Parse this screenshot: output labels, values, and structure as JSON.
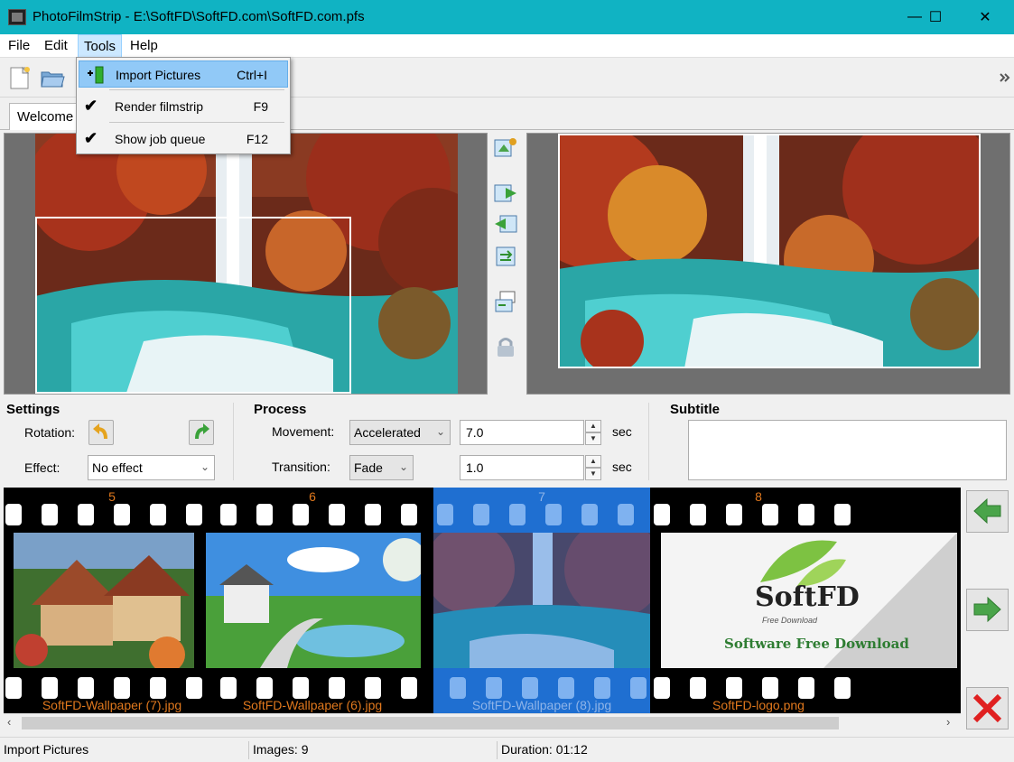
{
  "window": {
    "title": "PhotoFilmStrip - E:\\SoftFD\\SoftFD.com\\SoftFD.com.pfs",
    "minimize_glyph": "—",
    "maximize_glyph": "☐",
    "close_glyph": "✕"
  },
  "menubar": {
    "items": [
      "File",
      "Edit",
      "Tools",
      "Help"
    ]
  },
  "tools_menu": {
    "items": [
      {
        "label": "Import Pictures",
        "shortcut": "Ctrl+I",
        "icon": "import-pictures-icon"
      },
      {
        "label": "Render filmstrip",
        "shortcut": "F9",
        "icon": "checkmark-icon",
        "check": "✔"
      },
      {
        "label": "Show job queue",
        "shortcut": "F12",
        "icon": "checkmark-icon",
        "check": "✔"
      }
    ]
  },
  "tabs": {
    "active": "Welcome"
  },
  "settings": {
    "title": "Settings",
    "rotation_label": "Rotation:",
    "effect_label": "Effect:",
    "effect_value": "No effect"
  },
  "process": {
    "title": "Process",
    "movement_label": "Movement:",
    "movement_value": "Accelerated",
    "movement_duration": "7.0",
    "transition_label": "Transition:",
    "transition_value": "Fade",
    "transition_duration": "1.0",
    "unit": "sec"
  },
  "subtitle": {
    "title": "Subtitle",
    "value": ""
  },
  "filmstrip": {
    "frames": [
      {
        "number": "5",
        "name": "SoftFD-Wallpaper (7).jpg",
        "selected": false
      },
      {
        "number": "6",
        "name": "SoftFD-Wallpaper (6).jpg",
        "selected": false
      },
      {
        "number": "7",
        "name": "SoftFD-Wallpaper (8).jpg",
        "selected": true
      },
      {
        "number": "8",
        "name": "SoftFD-logo.png",
        "selected": false
      }
    ],
    "logo_text": "SoftFD",
    "logo_sub": "Free Download",
    "logo_tag": "Software Free Download"
  },
  "status": {
    "action": "Import Pictures",
    "images": "Images: 9",
    "duration": "Duration: 01:12"
  },
  "colors": {
    "titlebar": "#10b3c3",
    "film_label": "#e0781d",
    "selection": "#1f6fd1"
  }
}
